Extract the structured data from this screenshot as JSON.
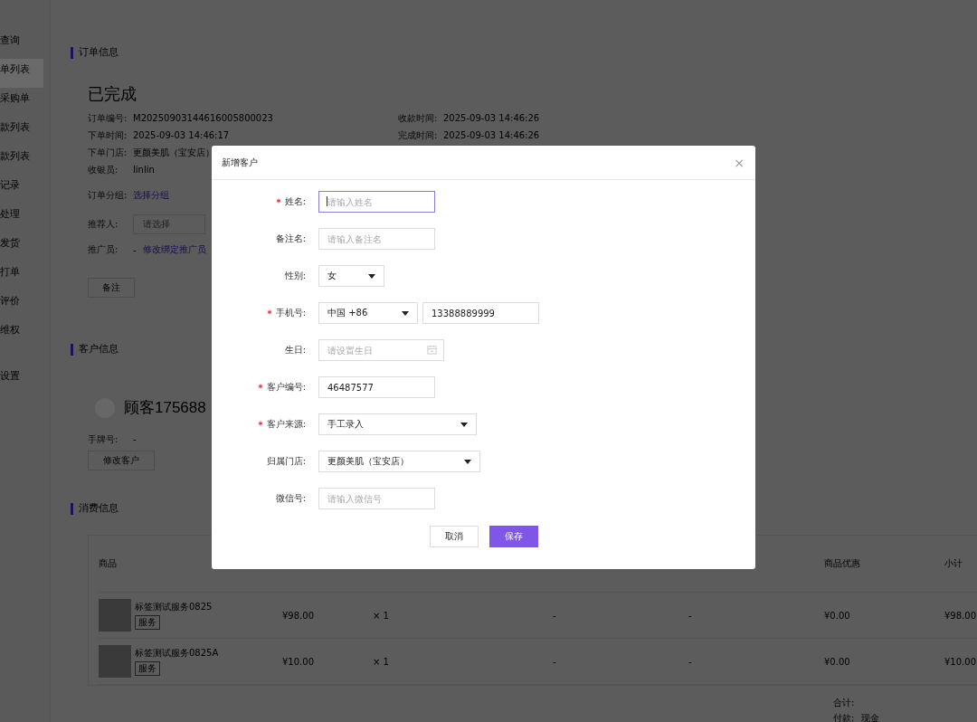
{
  "sidebar": {
    "items": [
      {
        "label": "查询",
        "selected": false
      },
      {
        "label": "单列表",
        "selected": true
      },
      {
        "label": "采购单",
        "selected": false
      },
      {
        "label": "款列表",
        "selected": false
      },
      {
        "label": "款列表",
        "selected": false
      },
      {
        "label": "记录",
        "selected": false
      },
      {
        "label": "处理",
        "selected": false
      },
      {
        "label": "发货",
        "selected": false
      },
      {
        "label": "打单",
        "selected": false
      },
      {
        "label": "评价",
        "selected": false
      },
      {
        "label": "维权",
        "selected": false
      },
      {
        "label": "设置",
        "selected": false
      }
    ]
  },
  "order_info": {
    "title": "订单信息",
    "status": "已完成",
    "fields_left": [
      {
        "label": "订单编号:",
        "value": "M20250903144616005800023"
      },
      {
        "label": "下单时间:",
        "value": "2025-09-03 14:46:17"
      },
      {
        "label": "下单门店:",
        "value": "更颜美肌（宝安店）"
      },
      {
        "label": "收银员:",
        "value": "linlin"
      }
    ],
    "fields_right": [
      {
        "label": "收款时间:",
        "value": "2025-09-03 14:46:26"
      },
      {
        "label": "完成时间:",
        "value": "2025-09-03 14:46:26"
      }
    ],
    "group": {
      "label": "订单分组:",
      "link": "选择分组"
    },
    "referrer": {
      "label": "推荐人:",
      "placeholder": "请选择"
    },
    "promoter": {
      "label": "推广员:",
      "value": "-",
      "link": "修改绑定推广员"
    },
    "note_button": "备注"
  },
  "customer_info": {
    "title": "客户信息",
    "name": "顾客175688",
    "hand_label": "手牌号:",
    "hand_value": "-",
    "edit_button": "修改客户"
  },
  "consumption": {
    "title": "消费信息",
    "columns": [
      "商品",
      "",
      "",
      "",
      "",
      "商品优惠",
      "小计"
    ],
    "rows": [
      {
        "name": "标签测试服务0825",
        "tag": "服务",
        "price": "¥98.00",
        "qty": "× 1",
        "column_4": "-",
        "column_5": "-",
        "discount": "¥0.00",
        "subtotal": "¥98.00"
      },
      {
        "name": "标签测试服务0825A",
        "tag": "服务",
        "price": "¥10.00",
        "qty": "× 1",
        "column_4": "-",
        "column_5": "-",
        "discount": "¥0.00",
        "subtotal": "¥10.00"
      }
    ],
    "total_label": "合计:",
    "payment_label": "付款:",
    "payment_method": "现金"
  },
  "dialog": {
    "title": "新增客户",
    "close": "×",
    "fields": [
      {
        "kind": "input",
        "label": "姓名:",
        "required": true,
        "placeholder": "请输入姓名",
        "focused": true
      },
      {
        "kind": "input",
        "label": "备注名:",
        "required": false,
        "placeholder": "请输入备注名",
        "focused": false
      },
      {
        "kind": "select",
        "label": "性别:",
        "required": false,
        "value": "女"
      },
      {
        "kind": "phone",
        "label": "手机号:",
        "required": true,
        "code": "中国 +86",
        "value": "13388889999"
      },
      {
        "kind": "date",
        "label": "生日:",
        "required": false,
        "placeholder": "请设置生日"
      },
      {
        "kind": "input",
        "label": "客户编号:",
        "required": true,
        "value": "46487577",
        "focused": false
      },
      {
        "kind": "select",
        "label": "客户来源:",
        "required": true,
        "value": "手工录入"
      },
      {
        "kind": "select",
        "label": "归属门店:",
        "required": false,
        "value": "更颜美肌（宝安店）"
      },
      {
        "kind": "input",
        "label": "微信号:",
        "required": false,
        "placeholder": "请输入微信号",
        "focused": false
      }
    ],
    "buttons": [
      {
        "label": "取消",
        "kind": "secondary"
      },
      {
        "label": "保存",
        "kind": "primary"
      }
    ]
  }
}
